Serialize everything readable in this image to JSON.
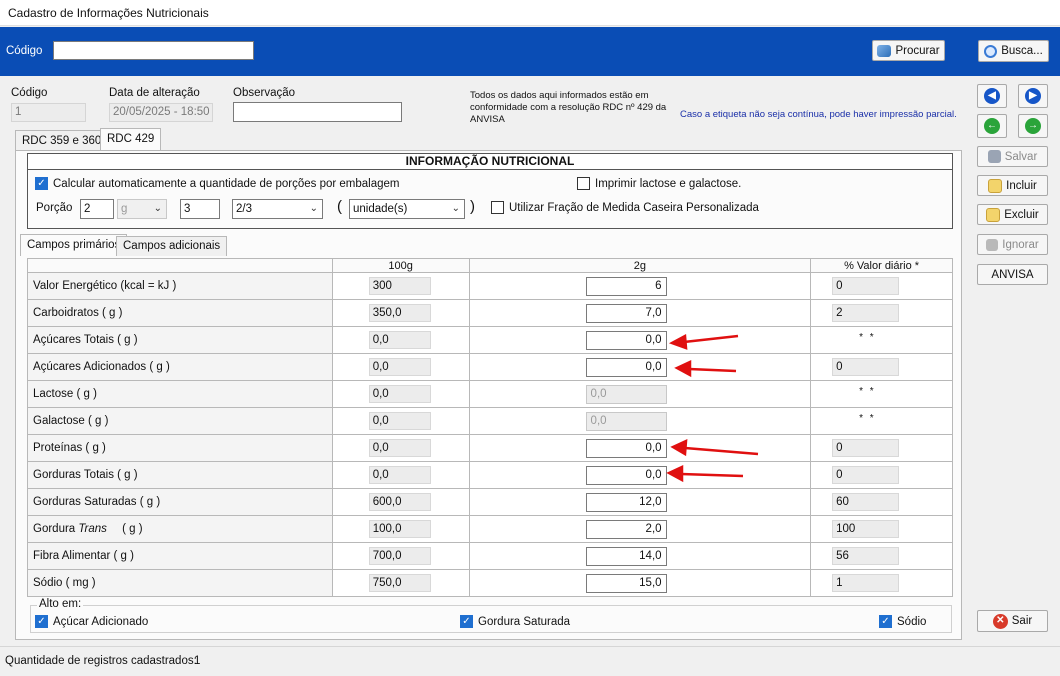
{
  "window": {
    "title": "Cadastro de Informações Nutricionais"
  },
  "search_bar": {
    "codigo_label": "Código",
    "codigo_value": "",
    "procurar_label": "Procurar",
    "busca_label": "Busca..."
  },
  "header": {
    "codigo_label": "Código",
    "codigo_value": "1",
    "data_label": "Data de alteração",
    "data_value": "20/05/2025 - 18:50",
    "obs_label": "Observação",
    "obs_value": "",
    "notice": "Todos os dados aqui informados estão em conformidade com a resolução RDC nº 429 da ANVISA",
    "etiqueta_note": "Caso a etiqueta não seja contínua, pode haver impressão parcial."
  },
  "side_buttons": {
    "salvar": "Salvar",
    "incluir": "Incluir",
    "excluir": "Excluir",
    "ignorar": "Ignorar",
    "anvisa": "ANVISA",
    "sair": "Sair"
  },
  "tabs": {
    "rdc359": "RDC 359 e 360",
    "rdc429": "RDC 429"
  },
  "info": {
    "title": "INFORMAÇÃO NUTRICIONAL",
    "calc_label": "Calcular automaticamente a quantidade de porções por embalagem",
    "lactose_label": "Imprimir lactose e galactose.",
    "porcao_label": "Porção",
    "porcao_value": "2",
    "unidade_g": "g",
    "qtd_value": "3",
    "fracao_value": "2/3",
    "paren_open": "(",
    "medida_value": "unidade(s)",
    "paren_close": ")",
    "fracao_label": "Utilizar Fração de Medida Caseira Personalizada"
  },
  "subtabs": {
    "primarios": "Campos primários",
    "adicionais": "Campos adicionais"
  },
  "grid": {
    "headers": [
      "",
      "100g",
      "2g",
      "% Valor diário *"
    ],
    "rows": [
      {
        "name": "Valor Energético (kcal = kJ )",
        "v100": "300",
        "vp": "6",
        "vd": "0"
      },
      {
        "name": "Carboidratos ( g )",
        "v100": "350,0",
        "vp": "7,0",
        "vd": "2"
      },
      {
        "name": "Açúcares Totais ( g )",
        "v100": "0,0",
        "vp": "0,0",
        "vd": "* *"
      },
      {
        "name": "Açúcares Adicionados ( g )",
        "v100": "0,0",
        "vp": "0,0",
        "vd": "0"
      },
      {
        "name": "Lactose ( g )",
        "v100": "0,0",
        "vp": "0,0",
        "vd": "* *"
      },
      {
        "name": "Galactose ( g )",
        "v100": "0,0",
        "vp": "0,0",
        "vd": "* *"
      },
      {
        "name": "Proteínas ( g )",
        "v100": "0,0",
        "vp": "0,0",
        "vd": "0"
      },
      {
        "name": "Gorduras Totais ( g )",
        "v100": "0,0",
        "vp": "0,0",
        "vd": "0"
      },
      {
        "name": "Gorduras Saturadas ( g )",
        "v100": "600,0",
        "vp": "12,0",
        "vd": "60"
      },
      {
        "name": "Gordura Trans",
        "name_suffix": "( g )",
        "v100": "100,0",
        "vp": "2,0",
        "vd": "100"
      },
      {
        "name": "Fibra Alimentar ( g )",
        "v100": "700,0",
        "vp": "14,0",
        "vd": "56"
      },
      {
        "name": "Sódio ( mg )",
        "v100": "750,0",
        "vp": "15,0",
        "vd": "1"
      }
    ]
  },
  "alto_em": {
    "label": "Alto em:",
    "acucar": "Açúcar Adicionado",
    "gordura": "Gordura Saturada",
    "sodio": "Sódio"
  },
  "status": {
    "label": "Quantidade de registros cadastrados:",
    "count": "1"
  }
}
